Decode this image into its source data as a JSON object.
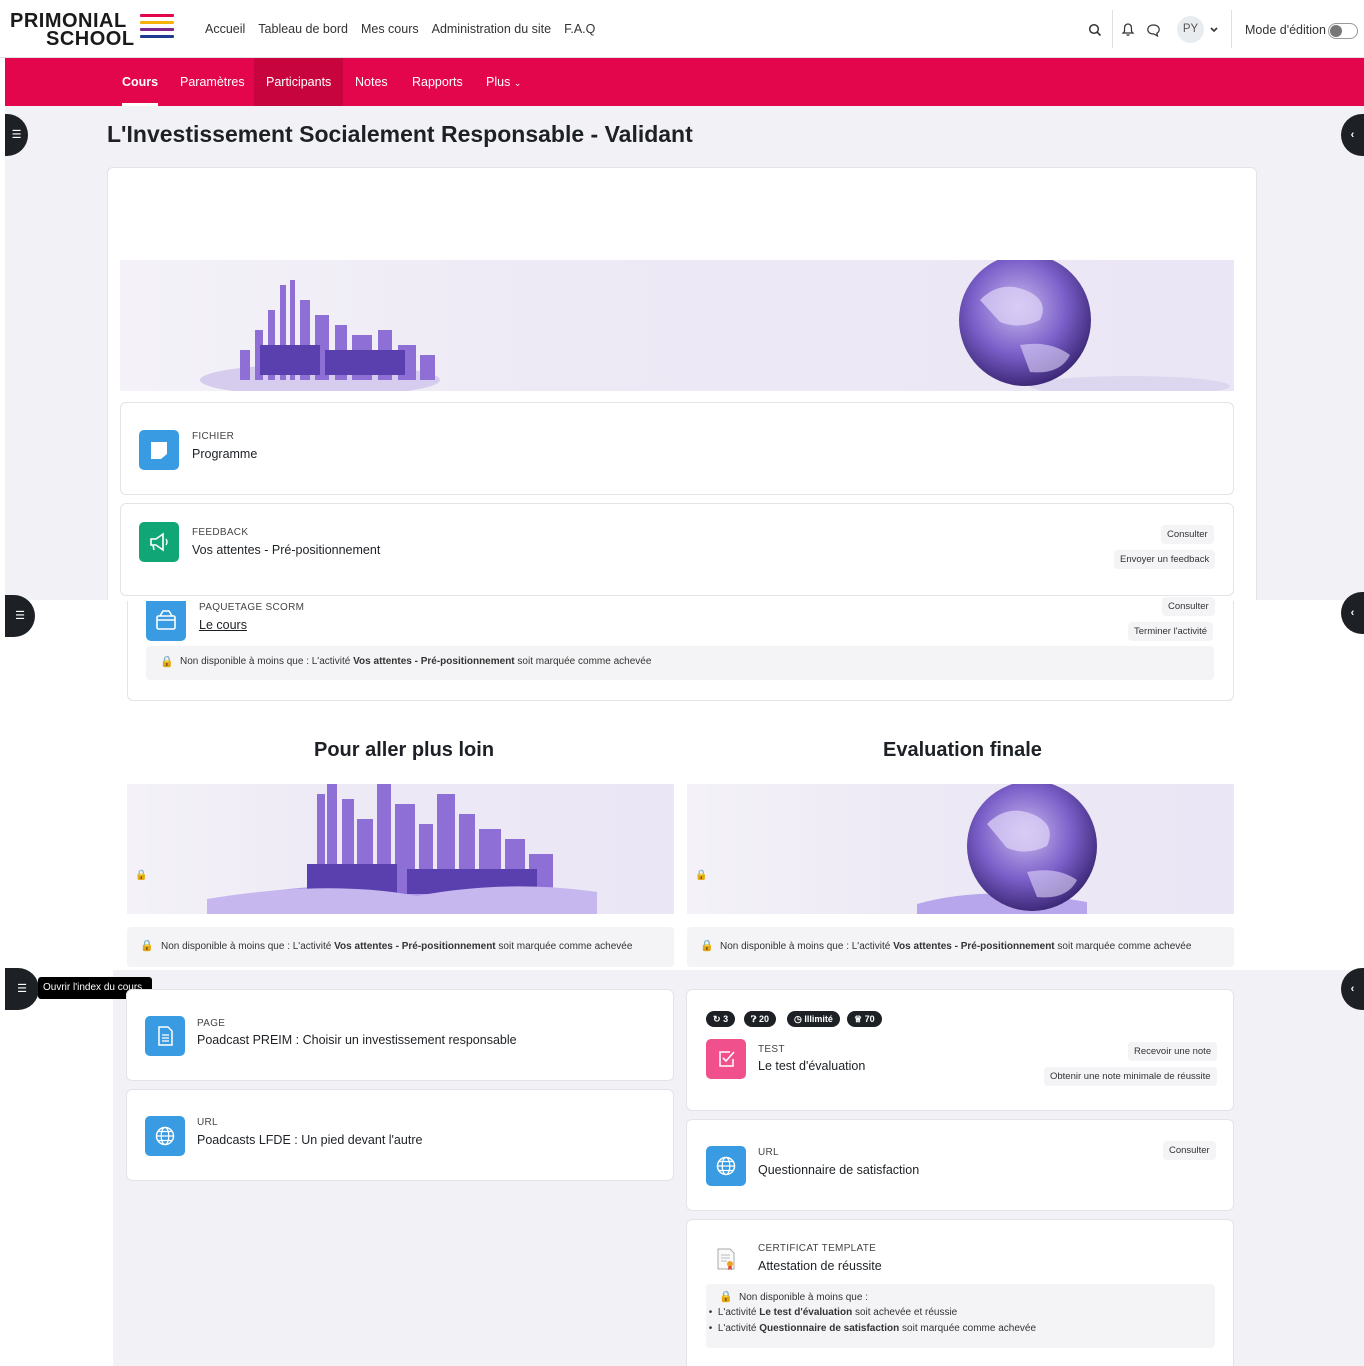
{
  "brand": {
    "line1": "PRIMONIAL",
    "line2": "SCHOOL",
    "colors": [
      "#e4064d",
      "#f6b40a",
      "#7a2a8c",
      "#1f3a93"
    ]
  },
  "nav": {
    "links": [
      "Accueil",
      "Tableau de bord",
      "Mes cours",
      "Administration du site",
      "F.A.Q"
    ],
    "avatar_initials": "PY",
    "edit_mode_label": "Mode d'édition"
  },
  "secondary_nav": {
    "tabs": [
      "Cours",
      "Paramètres",
      "Participants",
      "Notes",
      "Rapports",
      "Plus"
    ],
    "active": "Cours"
  },
  "page": {
    "title": "L'Investissement Socialement Responsable - Validant"
  },
  "activities": {
    "fichier": {
      "type": "FICHIER",
      "name": "Programme"
    },
    "feedback": {
      "type": "FEEDBACK",
      "name": "Vos attentes - Pré-positionnement",
      "btn1": "Consulter",
      "btn2": "Envoyer un feedback"
    },
    "scorm": {
      "type": "PAQUETAGE SCORM",
      "name": "Le cours",
      "btn1": "Consulter",
      "btn2": "Terminer l'activité",
      "restriction_pre": "Non disponible à moins que : L'activité ",
      "restriction_bold": "Vos attentes - Pré-positionnement",
      "restriction_post": " soit marquée comme achevée"
    }
  },
  "sections": {
    "left": {
      "title": "Pour aller plus loin",
      "restriction_pre": "Non disponible à moins que : L'activité ",
      "restriction_bold": "Vos attentes - Pré-positionnement",
      "restriction_post": " soit marquée comme achevée",
      "page": {
        "type": "PAGE",
        "name": "Poadcast PREIM : Choisir un investissement responsable"
      },
      "url": {
        "type": "URL",
        "name": "Poadcasts LFDE : Un pied devant l'autre"
      }
    },
    "right": {
      "title": "Evaluation finale",
      "restriction_pre": "Non disponible à moins que : L'activité ",
      "restriction_bold": "Vos attentes - Pré-positionnement",
      "restriction_post": " soit marquée comme achevée",
      "test": {
        "badges": [
          "3",
          "20",
          "Illimité",
          "70"
        ],
        "type": "TEST",
        "name": "Le test d'évaluation",
        "btn1": "Recevoir une note",
        "btn2": "Obtenir une note minimale de réussite"
      },
      "url": {
        "type": "URL",
        "name": "Questionnaire de satisfaction",
        "btn1": "Consulter"
      },
      "certificate": {
        "type": "CERTIFICAT TEMPLATE",
        "name": "Attestation de réussite",
        "restriction_head": "Non disponible à moins que :",
        "r1_pre": "L'activité ",
        "r1_bold": "Le test d'évaluation",
        "r1_post": " soit achevée et réussie",
        "r2_pre": "L'activité ",
        "r2_bold": "Questionnaire de satisfaction",
        "r2_post": " soit marquée comme achevée"
      }
    }
  },
  "tooltip": "Ouvrir l'index du cours"
}
